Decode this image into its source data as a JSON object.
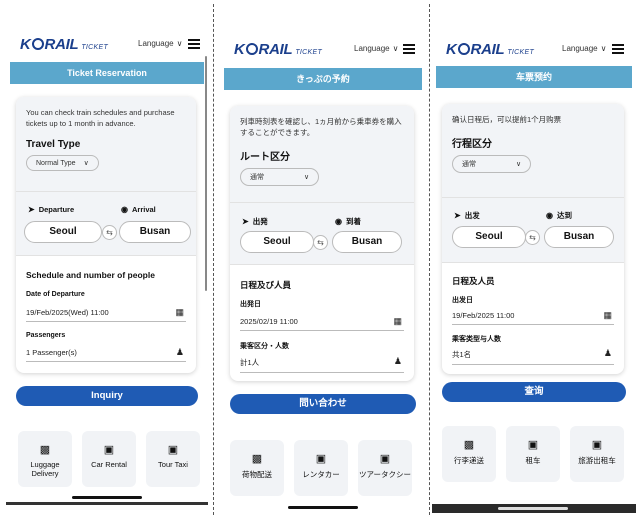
{
  "logo": {
    "brand": "KORAIL",
    "sub": "TICKET"
  },
  "panels": {
    "en": {
      "language": "Language",
      "banner": "Ticket Reservation",
      "intro": "You can check train schedules and purchase tickets up to 1 month in advance.",
      "travel_type_title": "Travel Type",
      "travel_type_value": "Normal Type",
      "departure_label": "Departure",
      "arrival_label": "Arrival",
      "departure_station": "Seoul",
      "arrival_station": "Busan",
      "schedule_title": "Schedule and number of people",
      "date_label": "Date of Departure",
      "date_value": "19/Feb/2025(Wed) 11:00",
      "passengers_label": "Passengers",
      "passengers_value": "1 Passenger(s)",
      "inquiry": "Inquiry",
      "services": [
        "Luggage Delivery",
        "Car Rental",
        "Tour Taxi"
      ]
    },
    "ja": {
      "language": "Language",
      "banner": "きっぷの予約",
      "intro": "列車時刻表を確認し、1ヵ月前から乗車券を購入することができます。",
      "travel_type_title": "ルート区分",
      "travel_type_value": "通常",
      "departure_label": "出発",
      "arrival_label": "到着",
      "departure_station": "Seoul",
      "arrival_station": "Busan",
      "schedule_title": "日程及び人員",
      "date_label": "出発日",
      "date_value": "2025/02/19 11:00",
      "passengers_label": "乗客区分・人数",
      "passengers_value": "計1人",
      "inquiry": "問い合わせ",
      "services": [
        "荷物配送",
        "レンタカー",
        "ツアータクシー"
      ]
    },
    "zh": {
      "language": "Language",
      "banner": "车票预约",
      "intro": "确认日程后，可以提前1个月购票",
      "travel_type_title": "行程区分",
      "travel_type_value": "通常",
      "departure_label": "出发",
      "arrival_label": "达到",
      "departure_station": "Seoul",
      "arrival_station": "Busan",
      "schedule_title": "日程及人员",
      "date_label": "出发日",
      "date_value": "19/Feb/2025 11:00",
      "passengers_label": "乘客类型与人数",
      "passengers_value": "共1名",
      "inquiry": "查询",
      "services": [
        "行李递送",
        "租车",
        "旅游出租车"
      ]
    }
  },
  "icons": {
    "departure": "plane-icon",
    "arrival": "location-pin-icon",
    "swap": "swap-icon",
    "calendar": "calendar-icon",
    "person": "person-icon",
    "luggage": "luggage-icon",
    "car": "car-icon",
    "taxi": "taxi-icon"
  },
  "colors": {
    "brand": "#1b3f8c",
    "banner": "#5ba7cc",
    "button": "#1f5bb4"
  }
}
